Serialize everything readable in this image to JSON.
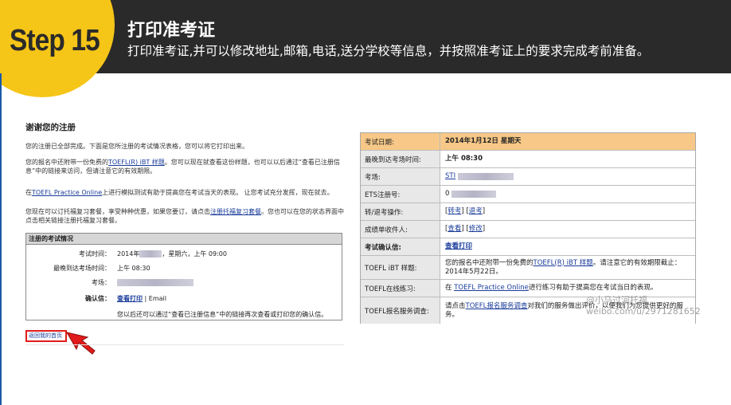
{
  "header": {
    "step_label": "Step 15",
    "title": "打印准考证",
    "subtitle": "打印准考证,并可以修改地址,邮箱,电话,送分学校等信息，并按照准考证上的要求完成考前准备。"
  },
  "left_screenshot": {
    "title": "谢谢您的注册",
    "para1": "您的注册已全部完成。下面是您所注册的考试情况表格，您可以将它打印出来。",
    "para2_before": "您的报名中还附带一份免费的",
    "para2_link": "TOEFL(R) iBT 样题",
    "para2_after": "。您可以现在就查看这份样题，也可以以后通过“查看已注册信息”中的链接来访问，但请注意它的有效期限。",
    "para3_before": "在",
    "para3_link": "TOEFL Practice Online",
    "para3_after": "上进行模拟测试有助于提高您在考试当天的表现。 让您考试充分发挥，现在就去。",
    "para4_before": "您现在可以订托福复习套餐，享受种种优惠，如果您要订，请点击",
    "para4_link": "注册托福复习套餐",
    "para4_after": "。您也可以在您的状态界面中点击相关链接注册托福复习套餐。",
    "box_title": "注册的考试情况",
    "rows": [
      {
        "label": "考试时间：",
        "value_prefix": "2014年",
        "value_suffix": "，星期六，上午 09:00"
      },
      {
        "label": "最晚到达考场时间：",
        "value_prefix": "上午 08:30",
        "value_suffix": ""
      },
      {
        "label": "考场：",
        "value_prefix": "",
        "value_suffix": ""
      }
    ],
    "confirm_label": "确认信：",
    "confirm_link": "查看打印",
    "confirm_sep": " | ",
    "confirm_email": "Email",
    "footnote": "您以后还可以通过“查看已注册信息”中的链接再次查看或打印您的确认信。",
    "return_button": "返回我的首页"
  },
  "right_screenshot": {
    "rows": [
      {
        "label": "考试日期:",
        "value": "2014年1月12日 星期天"
      },
      {
        "label": "最晚到达考场时间:",
        "value": "上午 08:30"
      },
      {
        "label": "考场:",
        "value": "STI"
      },
      {
        "label": "ETS注册号:",
        "value": "0"
      },
      {
        "label": "转/退考操作:",
        "link1": "转考",
        "link2": "退考"
      },
      {
        "label": "成绩单收件人:",
        "link1": "查看",
        "link2": "修改"
      },
      {
        "label": "考试确认信:",
        "value": "查看打印"
      },
      {
        "label": "TOEFL iBT 样题:",
        "before": "您的报名中还附带一份免费的",
        "link": "TOEFL(R) iBT 样题",
        "after": "。请注意它的有效期限截止：2014年5月22日。"
      },
      {
        "label": "TOEFL在线练习:",
        "before": "在 ",
        "link": "TOEFL Practice Online",
        "after": "进行练习有助于提高您在考试当日的表现。"
      },
      {
        "label": "TOEFL报名服务调查:",
        "before": "请点击",
        "link": "TOEFL报名服务调查",
        "after": "对我们的服务做出评价，以便我们为您提供更好的服务。"
      }
    ],
    "watermark_line1": "@小马过河托福",
    "watermark_line2": "weibo.com/u/2971281652"
  },
  "colors": {
    "header_bg": "#2a2a2a",
    "step_circle": "#f5c518",
    "highlight_row": "#f7c887",
    "link": "#1a3c9a",
    "return_border": "#e11b1b"
  }
}
